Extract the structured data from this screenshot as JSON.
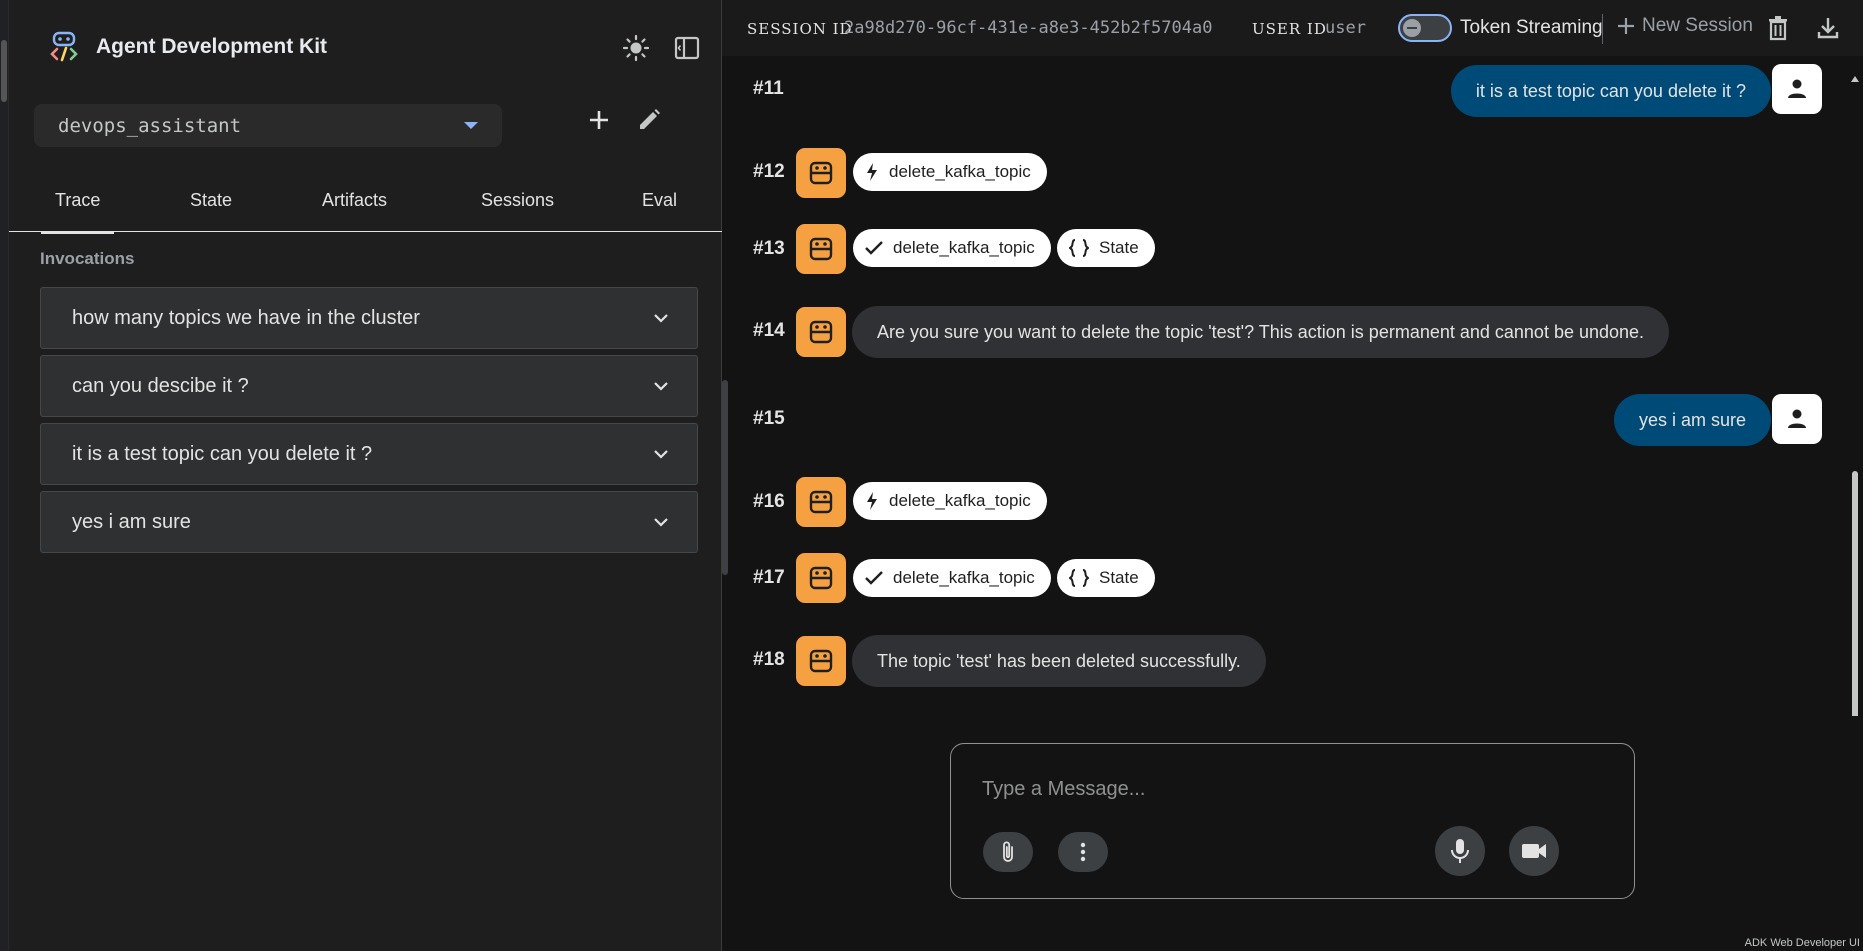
{
  "sidebar": {
    "app_title": "Agent Development Kit",
    "agent_select": {
      "value": "devops_assistant"
    },
    "tabs": [
      {
        "label": "Trace",
        "active": true
      },
      {
        "label": "State",
        "active": false
      },
      {
        "label": "Artifacts",
        "active": false
      },
      {
        "label": "Sessions",
        "active": false
      },
      {
        "label": "Eval",
        "active": false
      }
    ],
    "section_label": "Invocations",
    "invocations": [
      "how many topics we have in the cluster",
      "can you descibe it ?",
      "it is a test topic can you delete it ?",
      "yes i am sure"
    ]
  },
  "header": {
    "session_label": "SESSION ID",
    "session_id": "2a98d270-96cf-431e-a8e3-452b2f5704a0",
    "user_label": "USER ID",
    "user_id": "user",
    "streaming_label": "Token Streaming",
    "streaming_on": false,
    "new_session_label": "New Session"
  },
  "chat": {
    "messages": [
      {
        "num": "#11",
        "role": "user",
        "kind": "text",
        "text": "it is a test topic can you delete it ?"
      },
      {
        "num": "#12",
        "role": "bot",
        "kind": "chips",
        "chips": [
          {
            "icon": "bolt",
            "label": "delete_kafka_topic"
          }
        ]
      },
      {
        "num": "#13",
        "role": "bot",
        "kind": "chips",
        "chips": [
          {
            "icon": "check",
            "label": "delete_kafka_topic"
          },
          {
            "icon": "braces",
            "label": "State"
          }
        ]
      },
      {
        "num": "#14",
        "role": "bot",
        "kind": "text",
        "text": "Are you sure you want to delete the topic 'test'? This action is permanent and cannot be undone."
      },
      {
        "num": "#15",
        "role": "user",
        "kind": "text",
        "text": "yes i am sure"
      },
      {
        "num": "#16",
        "role": "bot",
        "kind": "chips",
        "chips": [
          {
            "icon": "bolt",
            "label": "delete_kafka_topic"
          }
        ]
      },
      {
        "num": "#17",
        "role": "bot",
        "kind": "chips",
        "chips": [
          {
            "icon": "check",
            "label": "delete_kafka_topic"
          },
          {
            "icon": "braces",
            "label": "State"
          }
        ]
      },
      {
        "num": "#18",
        "role": "bot",
        "kind": "text",
        "text": "The topic 'test' has been deleted successfully."
      }
    ]
  },
  "composer": {
    "placeholder": "Type a Message..."
  },
  "footer": {
    "text": "ADK Web Developer UI"
  },
  "colors": {
    "bot_avatar": "#f5a142",
    "user_bubble": "#004a77",
    "bot_bubble": "#303134",
    "accent": "#8ab4f8"
  }
}
